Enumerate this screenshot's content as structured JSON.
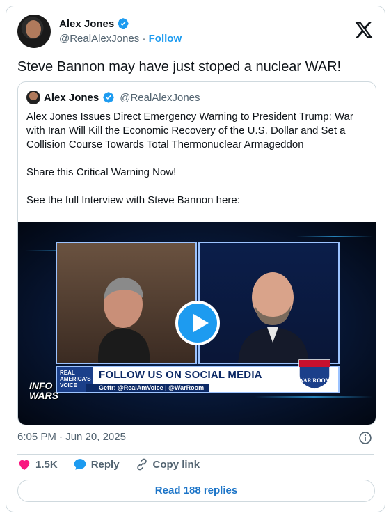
{
  "author": {
    "name": "Alex Jones",
    "handle": "@RealAlexJones",
    "separator": "·",
    "follow_label": "Follow"
  },
  "tweet": {
    "text": "Steve Bannon may have just stoped a nuclear WAR!"
  },
  "quote": {
    "name": "Alex Jones",
    "handle": "@RealAlexJones",
    "paragraphs": [
      "Alex Jones Issues Direct Emergency Warning to President Trump: War with Iran Will Kill the Economic Recovery of the U.S. Dollar and Set a Collision Course Towards Total Thermonuclear Armageddon",
      "Share this Critical Warning Now!",
      "See the full Interview with Steve Bannon here:"
    ],
    "video": {
      "ticker_tag": "REAL AMERICA'S VOICE",
      "ticker_title": "FOLLOW US ON SOCIAL MEDIA",
      "ticker_sub": "Gettr: @RealAmVoice | @WarRoom",
      "brand_left": "INFO WARS",
      "brand_right": "WAR ROOM"
    }
  },
  "meta": {
    "timestamp": "6:05 PM · Jun 20, 2025"
  },
  "actions": {
    "likes": "1.5K",
    "reply_label": "Reply",
    "copy_link_label": "Copy link"
  },
  "read_replies_label": "Read 188 replies",
  "colors": {
    "accent": "#1d9bf0",
    "heart": "#f91880",
    "muted": "#536471",
    "border": "#cfd9de"
  },
  "icons": [
    "verified-badge-icon",
    "x-logo-icon",
    "play-icon",
    "info-icon",
    "heart-icon",
    "reply-icon",
    "link-icon"
  ]
}
